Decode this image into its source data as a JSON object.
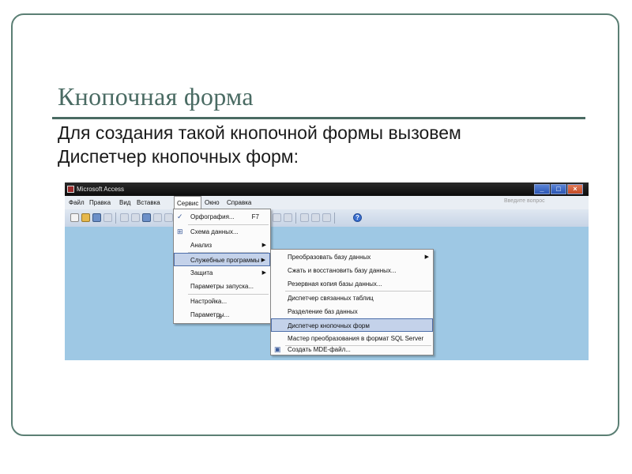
{
  "slide": {
    "title": "Кнопочная форма",
    "text_line1": "Для создания такой кнопочной формы вызовем",
    "text_line2": "Диспетчер кнопочных форм:"
  },
  "app": {
    "window_title": "Microsoft Access",
    "search_placeholder": "Введите вопрос",
    "menu": [
      "Файл",
      "Правка",
      "Вид",
      "Вставка",
      "Сервис",
      "Окно",
      "Справка"
    ]
  },
  "service_menu": {
    "items": [
      {
        "label": "Орфография...",
        "shortcut": "F7",
        "icon": "spellcheck-icon"
      },
      {
        "label": "Схема данных...",
        "icon": "relationships-icon"
      },
      {
        "label": "Анализ",
        "submenu": true
      },
      {
        "label": "Служебные программы",
        "submenu": true,
        "highlighted": true
      },
      {
        "label": "Защита",
        "submenu": true
      },
      {
        "label": "Параметры запуска..."
      },
      {
        "label": "Настройка..."
      },
      {
        "label": "Параметры..."
      }
    ],
    "expand_glyph": "»"
  },
  "utilities_submenu": {
    "items": [
      {
        "label": "Преобразовать базу данных",
        "submenu": true
      },
      {
        "label": "Сжать и восстановить базу данных..."
      },
      {
        "label": "Резервная копия базы данных..."
      },
      {
        "label": "Диспетчер связанных таблиц"
      },
      {
        "label": "Разделение баз данных"
      },
      {
        "label": "Диспетчер кнопочных форм",
        "highlighted": true
      },
      {
        "label": "Мастер преобразования в формат SQL Server"
      },
      {
        "label": "Создать MDE-файл...",
        "icon": "mde-file-icon"
      }
    ]
  },
  "colors": {
    "accent": "#4a6b63",
    "workspace": "#9ec8e4",
    "highlight": "#c4d2ea"
  }
}
